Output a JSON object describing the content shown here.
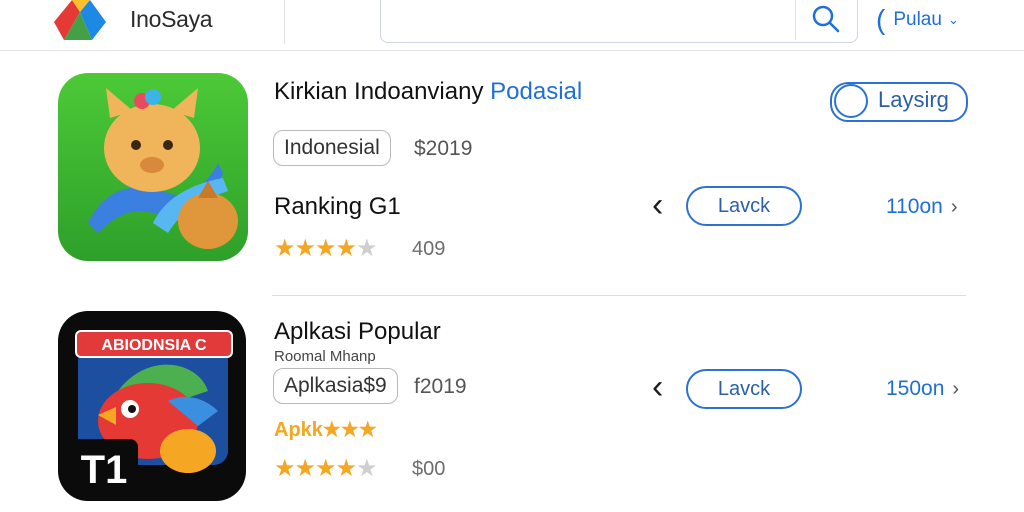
{
  "header": {
    "brand": "InoSaya",
    "search_placeholder": "",
    "region_label": "Pulau",
    "colors": {
      "accent": "#1e6fd9",
      "star": "#f5a623"
    }
  },
  "apps": [
    {
      "title_main": "Kirkian Indoanviany ",
      "title_accent": "Podasial",
      "get_label": "Laysirg",
      "tag": "Indonesial",
      "year": "$2019",
      "ranking": "Ranking G1",
      "rating": 4.5,
      "rating_count": "409",
      "button_label": "Lavck",
      "size": "110on",
      "icon": "fox-character-icon"
    },
    {
      "title_main": "Aplkasi Popular",
      "subtitle": "Roomal Mhanp",
      "tag": "Aplkasia$9",
      "year": "f2019",
      "promo": "Apkk★★★",
      "rating": 4.5,
      "rating_count": "$00",
      "button_label": "Lavck",
      "size": "150on",
      "banner": "ABIODNSIA C",
      "badge": "T1",
      "icon": "red-bird-icon"
    }
  ]
}
